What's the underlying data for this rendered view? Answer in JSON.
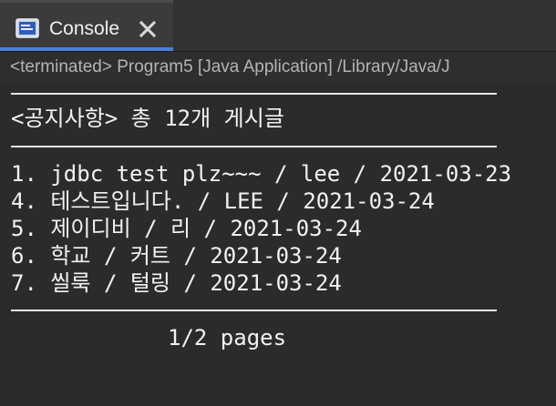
{
  "tab": {
    "label": "Console",
    "icon": "console-icon",
    "close_icon": "close-icon"
  },
  "status": {
    "text": "<terminated> Program5 [Java Application] /Library/Java/J"
  },
  "console": {
    "header": "<공지사항> 총 12개 게시글",
    "rows": [
      "1. jdbc test plz~~~ / lee / 2021-03-23",
      "4. 테스트입니다. / LEE / 2021-03-24",
      "5. 제이디비 / 리 / 2021-03-24",
      "6. 학교 / 커트 / 2021-03-24",
      "7. 씰룩 / 털링 / 2021-03-24"
    ],
    "pagination": "1/2 pages"
  },
  "colors": {
    "background": "#2b2b2b",
    "tab_accent": "#4d7fd6",
    "text": "#f2f2f2",
    "status_text": "#b4b4b4"
  }
}
